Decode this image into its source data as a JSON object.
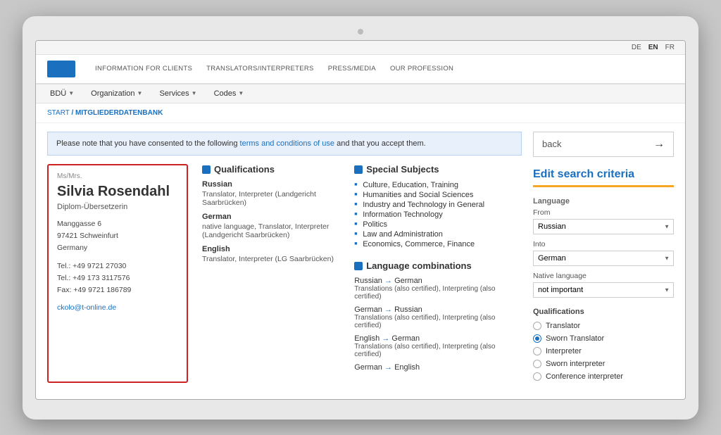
{
  "lang_bar": {
    "langs": [
      "DE",
      "EN",
      "FR"
    ],
    "active": "EN"
  },
  "main_nav": {
    "links": [
      {
        "label": "INFORMATION FOR CLIENTS"
      },
      {
        "label": "TRANSLATORS/INTERPRETERS"
      },
      {
        "label": "PRESS/MEDIA"
      },
      {
        "label": "OUR PROFESSION"
      }
    ]
  },
  "secondary_nav": {
    "items": [
      {
        "label": "BDÜ"
      },
      {
        "label": "Organization"
      },
      {
        "label": "Services"
      },
      {
        "label": "Codes"
      }
    ]
  },
  "breadcrumb": {
    "start": "START",
    "separator": " / ",
    "current": "MITGLIEDERDATENBANK"
  },
  "notice": {
    "text_before": "Please note that you have consented to the following ",
    "link_text": "terms and conditions of use",
    "text_after": " and that you accept them."
  },
  "profile": {
    "salutation": "Ms/Mrs.",
    "name": "Silvia Rosendahl",
    "title": "Diplom-Übersetzerin",
    "address_line1": "Manggasse 6",
    "address_line2": "97421 Schweinfurt",
    "address_line3": "Germany",
    "phone1": "Tel.: +49 9721 27030",
    "phone2": "Tel.: +49 173 3117576",
    "fax": "Fax: +49 9721 186789",
    "email": "ckolo@t-online.de"
  },
  "qualifications": {
    "section_title": "Qualifications",
    "items": [
      {
        "language": "Russian",
        "desc": "Translator, Interpreter (Landgericht Saarbrücken)"
      },
      {
        "language": "German",
        "desc": "native language, Translator, Interpreter (Landgericht Saarbrücken)"
      },
      {
        "language": "English",
        "desc": "Translator, Interpreter (LG Saarbrücken)"
      }
    ]
  },
  "special_subjects": {
    "title": "Special Subjects",
    "items": [
      "Culture, Education, Training",
      "Humanities and Social Sciences",
      "Industry and Technology in General",
      "Information Technology",
      "Politics",
      "Law and Administration",
      "Economics, Commerce, Finance"
    ]
  },
  "language_combinations": {
    "title": "Language combinations",
    "items": [
      {
        "from": "Russian",
        "to": "German",
        "desc": "Translations (also certified), Interpreting (also certified)"
      },
      {
        "from": "German",
        "to": "Russian",
        "desc": "Translations (also certified), Interpreting (also certified)"
      },
      {
        "from": "English",
        "to": "German",
        "desc": "Translations (also certified), Interpreting (also certified)"
      },
      {
        "from": "German",
        "to": "English",
        "desc": ""
      }
    ]
  },
  "sidebar": {
    "back_label": "back",
    "edit_title": "Edit search criteria",
    "language_section": {
      "label": "Language",
      "from_label": "From",
      "from_value": "Russian",
      "into_label": "Into",
      "into_value": "German",
      "native_label": "Native language",
      "native_value": "not important"
    },
    "qualifications_section": {
      "label": "Qualifications",
      "options": [
        {
          "label": "Translator",
          "checked": false
        },
        {
          "label": "Sworn Translator",
          "checked": true
        },
        {
          "label": "Interpreter",
          "checked": false
        },
        {
          "label": "Sworn interpreter",
          "checked": false
        },
        {
          "label": "Conference interpreter",
          "checked": false
        }
      ]
    }
  }
}
